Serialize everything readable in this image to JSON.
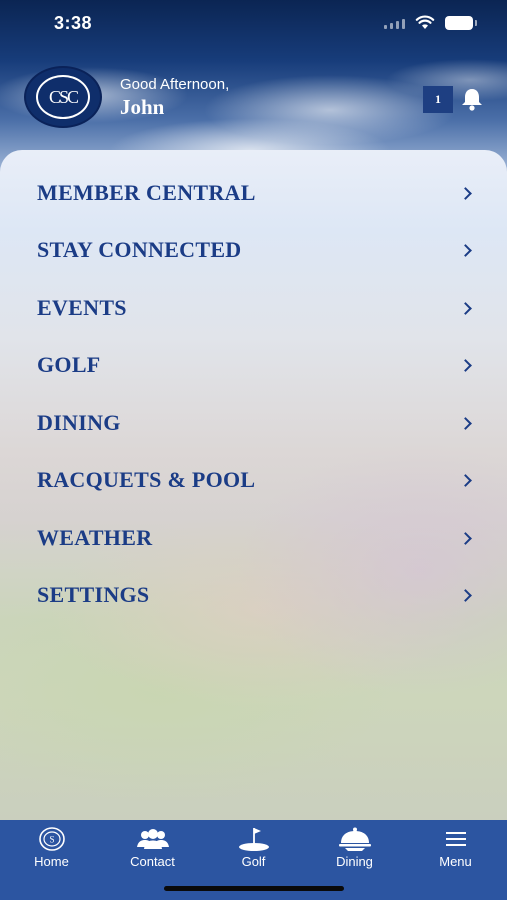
{
  "status_bar": {
    "time": "3:38"
  },
  "header": {
    "logo_text": "CSC",
    "greeting": "Good Afternoon,",
    "user_name": "John",
    "notification_count": "1"
  },
  "menu": {
    "items": [
      {
        "label": "MEMBER CENTRAL"
      },
      {
        "label": "STAY CONNECTED"
      },
      {
        "label": "EVENTS"
      },
      {
        "label": "GOLF"
      },
      {
        "label": "DINING"
      },
      {
        "label": "RACQUETS & POOL"
      },
      {
        "label": "WEATHER"
      },
      {
        "label": "SETTINGS"
      }
    ]
  },
  "tabbar": {
    "tabs": [
      {
        "label": "Home",
        "icon": "club-logo-icon"
      },
      {
        "label": "Contact",
        "icon": "people-icon"
      },
      {
        "label": "Golf",
        "icon": "golf-flag-icon"
      },
      {
        "label": "Dining",
        "icon": "cloche-icon"
      },
      {
        "label": "Menu",
        "icon": "hamburger-icon"
      }
    ]
  },
  "colors": {
    "accent": "#1b3c86",
    "tabbar": "#2c55a1",
    "badge": "#1e3f82"
  }
}
